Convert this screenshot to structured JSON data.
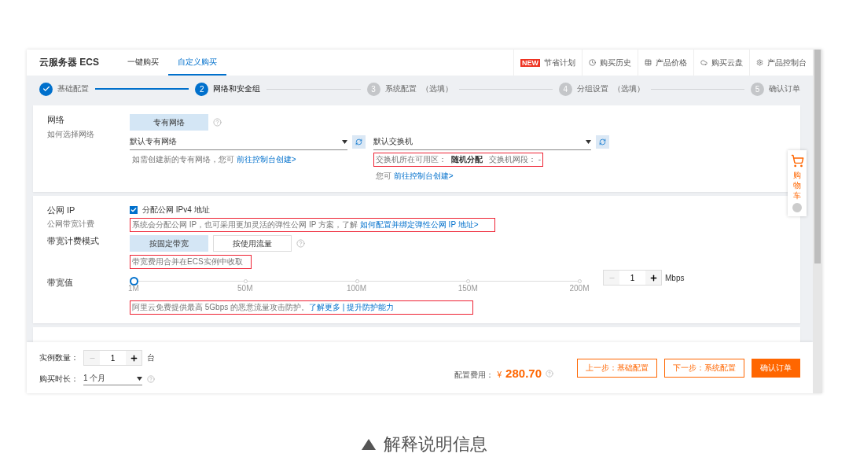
{
  "header": {
    "brand": "云服务器 ECS",
    "tabs": [
      {
        "label": "一键购买",
        "selected": false
      },
      {
        "label": "自定义购买",
        "selected": true
      }
    ],
    "links": [
      {
        "kind": "new",
        "badge": "NEW",
        "label": "节省计划"
      },
      {
        "kind": "clock",
        "label": "购买历史"
      },
      {
        "kind": "table",
        "label": "产品价格"
      },
      {
        "kind": "cloud",
        "label": "购买云盘"
      },
      {
        "kind": "gear",
        "label": "产品控制台"
      }
    ]
  },
  "steps": [
    {
      "done": true,
      "selected": false,
      "label": "基础配置"
    },
    {
      "done": false,
      "selected": true,
      "number": "2",
      "label": "网络和安全组"
    },
    {
      "done": false,
      "selected": false,
      "number": "3",
      "label": "系统配置",
      "note": "（选填）"
    },
    {
      "done": false,
      "selected": false,
      "number": "4",
      "label": "分组设置",
      "note": "（选填）"
    },
    {
      "done": false,
      "selected": false,
      "number": "5",
      "label": "确认订单"
    }
  ],
  "network": {
    "label": "网络",
    "help": "如何选择网络",
    "option": {
      "label": "专有网络",
      "selected": true
    },
    "vpc": {
      "value": "默认专有网络",
      "hint": "如需创建新的专有网络，您可",
      "link": "前往控制台创建>"
    },
    "vswitch": {
      "value": "默认交换机",
      "zone_label": "交换机所在可用区：",
      "zone_value": "随机分配",
      "cidr_label": "交换机网段：",
      "cidr_value": "-",
      "annotated": true,
      "hint": "您可",
      "link": "前往控制台创建>"
    }
  },
  "public_ip": {
    "label": "公网 IP",
    "sub": "公网带宽计费",
    "checkbox": {
      "label": "分配公网 IPv4 地址",
      "checked": true
    },
    "hint": "系统会分配公网 IP，也可采用更加灵活的弹性公网 IP 方案，了解",
    "link": "如何配置并绑定弹性公网 IP 地址>",
    "annotated": true
  },
  "billing": {
    "label": "带宽计费模式",
    "options": [
      {
        "label": "按固定带宽",
        "selected": true
      },
      {
        "label": "按使用流量",
        "selected": false
      }
    ],
    "hint": "带宽费用合并在ECS实例中收取",
    "annotated": true
  },
  "bandwidth": {
    "label": "带宽值",
    "level": 0,
    "ticks": [
      "1M",
      "50M",
      "100M",
      "150M",
      "200M"
    ],
    "value": "1",
    "unit": "Mbps",
    "hint": "阿里云免费提供最高 5Gbps 的恶意流量攻击防护。",
    "link1": "了解更多",
    "separator": "|",
    "link2": "提升防护能力",
    "annotated": true
  },
  "footer": {
    "quantity": {
      "label": "实例数量：",
      "value": "1",
      "unit": "台"
    },
    "duration": {
      "label": "购买时长：",
      "value": "1 个月"
    },
    "fee": {
      "label": "配置费用：",
      "currency": "¥",
      "amount": "280.70"
    },
    "buttons": [
      {
        "kind": "outline",
        "label": "上一步：基础配置"
      },
      {
        "kind": "outline",
        "label": "下一步：系统配置"
      },
      {
        "kind": "primary",
        "label": "确认订单"
      }
    ]
  },
  "cart": {
    "label": "购物车"
  },
  "caption": "解释说明信息"
}
